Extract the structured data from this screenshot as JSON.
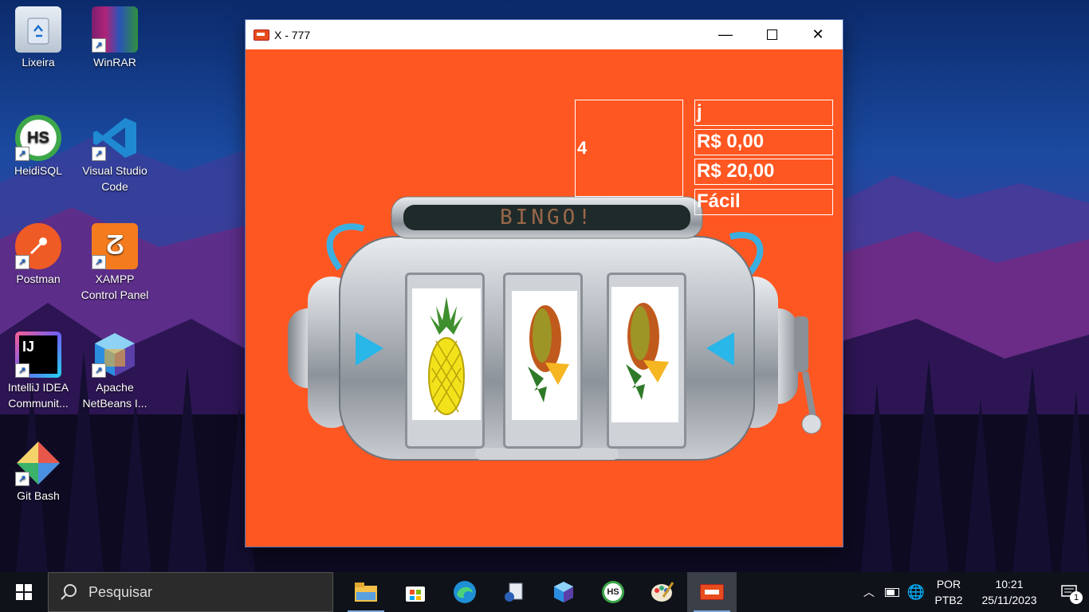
{
  "desktop": {
    "icons": [
      {
        "label": "Lixeira",
        "icon": "recycle-bin-icon"
      },
      {
        "label": "WinRAR",
        "icon": "winrar-icon"
      },
      {
        "label": "HeidiSQL",
        "icon": "heidisql-icon"
      },
      {
        "label": "Visual Studio Code",
        "icon": "vscode-icon"
      },
      {
        "label": "Postman",
        "icon": "postman-icon"
      },
      {
        "label": "XAMPP Control Panel",
        "icon": "xampp-icon"
      },
      {
        "label": "IntelliJ IDEA Communit...",
        "icon": "intellij-icon"
      },
      {
        "label": "Apache NetBeans I...",
        "icon": "netbeans-icon"
      },
      {
        "label": "Git Bash",
        "icon": "git-bash-icon"
      }
    ]
  },
  "window": {
    "title": "X -  777",
    "labels": {
      "counter": "4",
      "player": "j",
      "prize": "R$ 0,00",
      "balance": "R$ 20,00",
      "difficulty": "Fácil"
    },
    "marquee": "BINGO!",
    "reels": [
      "pineapple-icon",
      "mango-icon",
      "mango-icon"
    ]
  },
  "taskbar": {
    "search_placeholder": "Pesquisar",
    "apps": [
      "file-explorer-icon",
      "microsoft-store-icon",
      "edge-icon",
      "remote-desktop-icon",
      "netbeans-icon",
      "heidisql-icon",
      "paint-icon",
      "slot-game-icon"
    ],
    "tray": {
      "language": "POR",
      "layout": "PTB2",
      "time": "10:21",
      "date": "25/11/2023",
      "notifications": "1"
    }
  },
  "colors": {
    "game_background": "#ff5722",
    "taskbar": "#0f1319"
  }
}
